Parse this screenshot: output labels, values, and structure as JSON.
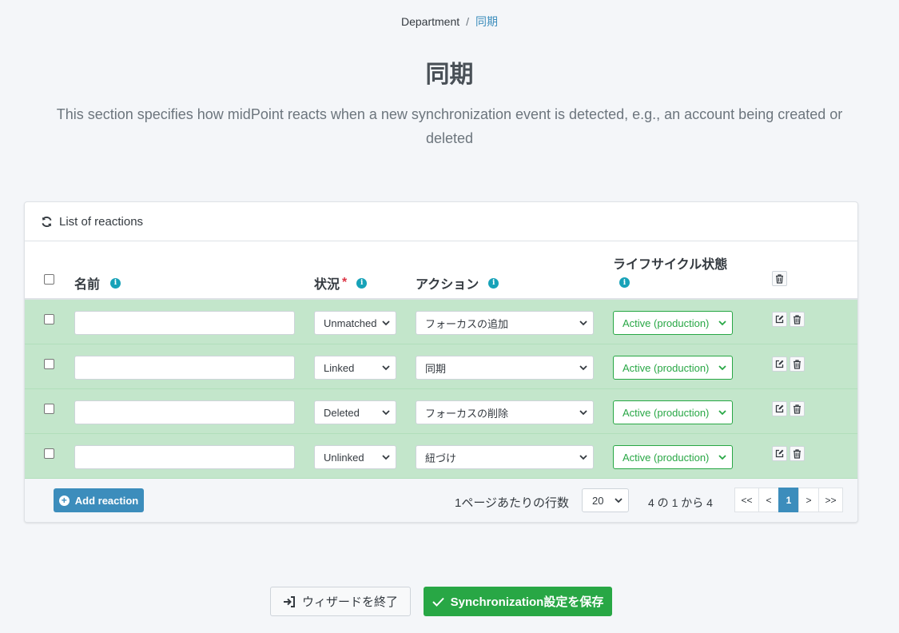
{
  "breadcrumb": {
    "parent": "Department",
    "separator": "/",
    "current": "同期"
  },
  "page": {
    "title": "同期",
    "description": "This section specifies how midPoint reacts when a new synchronization event is detected, e.g., an account being created or deleted"
  },
  "card": {
    "header_icon": "refresh-icon",
    "header_title": "List of reactions"
  },
  "table": {
    "columns": {
      "name": "名前",
      "situation": "状況",
      "action": "アクション",
      "lifecycle_line1": "ライフサイクル状態"
    },
    "required_mark": "*",
    "info_glyph": "i",
    "rows": [
      {
        "name": "",
        "situation": "Unmatched",
        "action": "フォーカスの追加",
        "lifecycle": "Active (production)"
      },
      {
        "name": "",
        "situation": "Linked",
        "action": "同期",
        "lifecycle": "Active (production)"
      },
      {
        "name": "",
        "situation": "Deleted",
        "action": "フォーカスの削除",
        "lifecycle": "Active (production)"
      },
      {
        "name": "",
        "situation": "Unlinked",
        "action": "紐づけ",
        "lifecycle": "Active (production)"
      }
    ]
  },
  "footer": {
    "add_label": "Add reaction",
    "rows_per_page_label": "1ページあたりの行数",
    "rows_per_page_value": "20",
    "count_label": "4 の 1 から 4",
    "pagination": {
      "first": "<<",
      "prev": "<",
      "current": "1",
      "next": ">",
      "last": ">>"
    }
  },
  "actions": {
    "exit_label": "ウィザードを終了",
    "save_label": "Synchronization設定を保存"
  },
  "colors": {
    "row_bg": "#c3e6cb",
    "primary": "#3c8dbc",
    "success": "#28a745",
    "info": "#17a2b8"
  }
}
